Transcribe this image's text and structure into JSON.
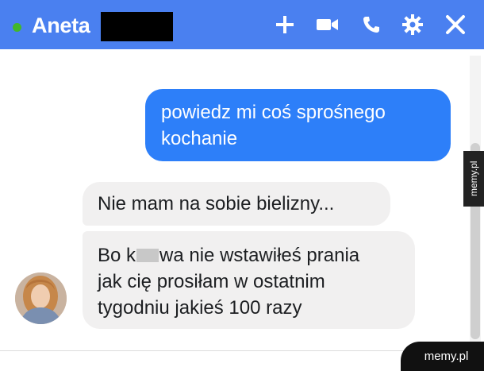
{
  "header": {
    "contact_name": "Aneta",
    "status": "online",
    "status_color": "#42b72a",
    "bar_color": "#4a80f0",
    "icons": [
      "plus-icon",
      "video-camera-icon",
      "phone-icon",
      "gear-icon",
      "close-icon"
    ]
  },
  "messages": [
    {
      "direction": "outgoing",
      "lines": [
        "powiedz mi coś sprośnego",
        "kochanie"
      ],
      "bubble_color": "#2d7ff9"
    },
    {
      "direction": "incoming",
      "lines": [
        "Nie mam na sobie bielizny..."
      ],
      "bubble_color": "#f1f0f0"
    },
    {
      "direction": "incoming",
      "lines_before_censor": "Bo k",
      "lines_after_censor": "wa nie wstawiłeś prania",
      "lines": [
        "jak cię prosiłam w ostatnim",
        "tygodniu jakieś 100 razy"
      ],
      "bubble_color": "#f1f0f0"
    }
  ],
  "watermarks": {
    "side": "memy.pl",
    "bottom": "memy.pl"
  }
}
